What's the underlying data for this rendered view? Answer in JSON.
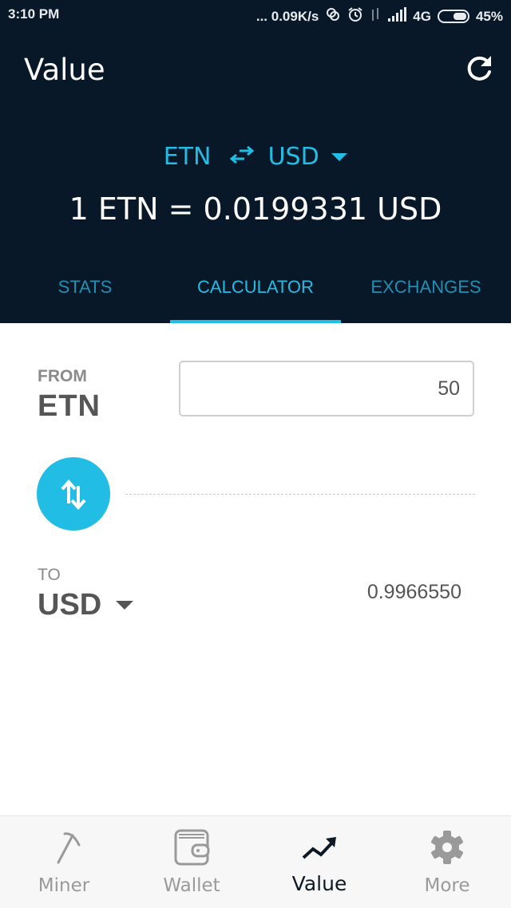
{
  "status_bar": {
    "time": "3:10 PM",
    "network_speed": "... 0.09K/s",
    "network_type": "4G",
    "battery": "45%"
  },
  "app_bar": {
    "title": "Value",
    "refresh_icon": "refresh-icon"
  },
  "pair": {
    "base": "ETN",
    "swap_icon": "swap-horizontal-icon",
    "quote": "USD"
  },
  "rate_text": "1 ETN = 0.0199331 USD",
  "tabs": [
    {
      "label": "STATS",
      "active": false
    },
    {
      "label": "CALCULATOR",
      "active": true
    },
    {
      "label": "EXCHANGES",
      "active": false
    }
  ],
  "calculator": {
    "from_label": "FROM",
    "from_currency": "ETN",
    "amount": "50",
    "swap_icon": "swap-vertical-icon",
    "to_label": "TO",
    "to_currency": "USD",
    "result": "0.9966550"
  },
  "bottom_nav": [
    {
      "label": "Miner",
      "icon": "pickaxe-icon",
      "active": false
    },
    {
      "label": "Wallet",
      "icon": "wallet-icon",
      "active": false
    },
    {
      "label": "Value",
      "icon": "trending-up-icon",
      "active": true
    },
    {
      "label": "More",
      "icon": "gear-icon",
      "active": false
    }
  ],
  "colors": {
    "header_bg": "#081828",
    "accent": "#22bde4",
    "tab_inactive": "#1f8fb3",
    "text_gray": "#555555",
    "nav_inactive": "#9a9a9a",
    "nav_active": "#0d1a26"
  }
}
